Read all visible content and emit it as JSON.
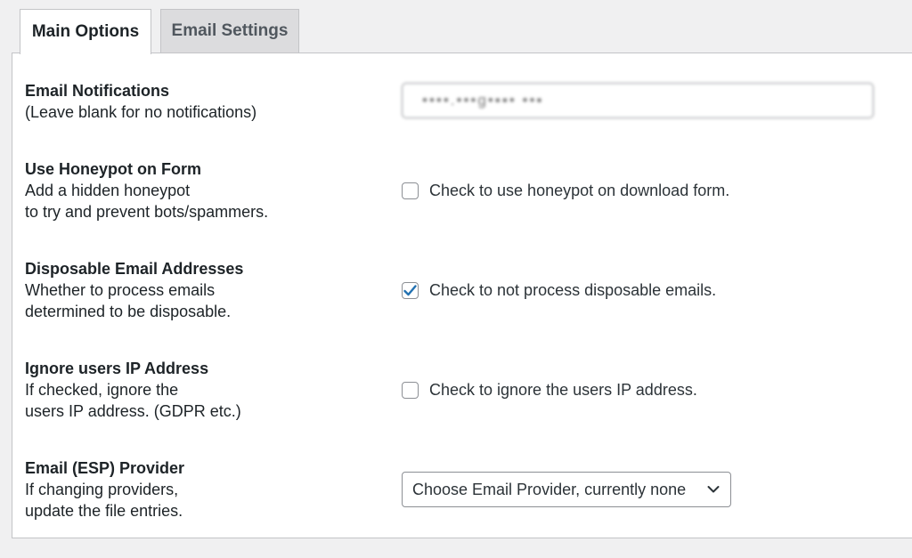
{
  "tabs": [
    {
      "label": "Main Options",
      "active": true
    },
    {
      "label": "Email Settings",
      "active": false
    }
  ],
  "settings": {
    "email_notifications": {
      "title": "Email Notifications",
      "desc": [
        "(Leave blank for no notifications)"
      ],
      "value": "••••.•••ɡ•▪▪• ••▪"
    },
    "honeypot": {
      "title": "Use Honeypot on Form",
      "desc": [
        "Add a hidden honeypot",
        "to try and prevent bots/spammers."
      ],
      "checkbox_label": "Check to use honeypot on download form.",
      "checked": false
    },
    "disposable": {
      "title": "Disposable Email Addresses",
      "desc": [
        "Whether to process emails",
        "determined to be disposable."
      ],
      "checkbox_label": "Check to not process disposable emails.",
      "checked": true
    },
    "ignore_ip": {
      "title": "Ignore users IP Address",
      "desc": [
        "If checked, ignore the",
        "users IP address. (GDPR etc.)"
      ],
      "checkbox_label": "Check to ignore the users IP address.",
      "checked": false
    },
    "esp_provider": {
      "title": "Email (ESP) Provider",
      "desc": [
        "If changing providers,",
        "update the file entries."
      ],
      "selected": "Choose Email Provider, currently none"
    }
  },
  "colors": {
    "checkmark": "#2271b1",
    "panel_border": "#c3c4c7",
    "inactive_tab_bg": "#dcdcde"
  }
}
